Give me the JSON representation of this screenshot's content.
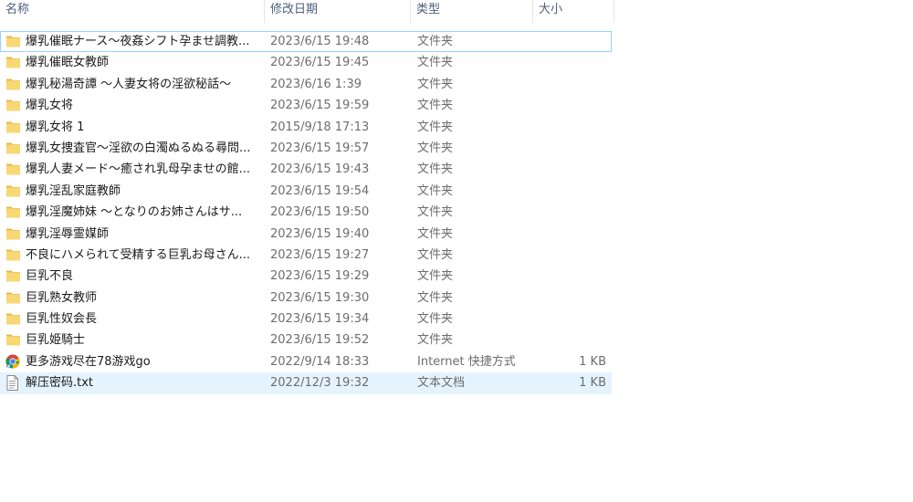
{
  "columns": {
    "name": "名称",
    "date": "修改日期",
    "type": "类型",
    "size": "大小"
  },
  "files": [
    {
      "name": "爆乳催眠ナース～夜姦シフト孕ませ調教...",
      "date": "2023/6/15 19:48",
      "type": "文件夹",
      "size": "",
      "icon": "folder-icon"
    },
    {
      "name": "爆乳催眠女教師",
      "date": "2023/6/15 19:45",
      "type": "文件夹",
      "size": "",
      "icon": "folder-icon"
    },
    {
      "name": "爆乳秘湯奇譚 ～人妻女将の淫欲秘話～",
      "date": "2023/6/16 1:39",
      "type": "文件夹",
      "size": "",
      "icon": "folder-icon"
    },
    {
      "name": "爆乳女将",
      "date": "2023/6/15 19:59",
      "type": "文件夹",
      "size": "",
      "icon": "folder-icon"
    },
    {
      "name": "爆乳女将 1",
      "date": "2015/9/18 17:13",
      "type": "文件夹",
      "size": "",
      "icon": "folder-icon"
    },
    {
      "name": "爆乳女捜査官～淫欲の白濁ぬるぬる尋問...",
      "date": "2023/6/15 19:57",
      "type": "文件夹",
      "size": "",
      "icon": "folder-icon"
    },
    {
      "name": "爆乳人妻メード～癒され乳母孕ませの館...",
      "date": "2023/6/15 19:43",
      "type": "文件夹",
      "size": "",
      "icon": "folder-icon"
    },
    {
      "name": "爆乳淫乱家庭教師",
      "date": "2023/6/15 19:54",
      "type": "文件夹",
      "size": "",
      "icon": "folder-icon"
    },
    {
      "name": "爆乳淫魔姉妹 ～となりのお姉さんはサ...",
      "date": "2023/6/15 19:50",
      "type": "文件夹",
      "size": "",
      "icon": "folder-icon"
    },
    {
      "name": "爆乳淫辱霊媒師",
      "date": "2023/6/15 19:40",
      "type": "文件夹",
      "size": "",
      "icon": "folder-icon"
    },
    {
      "name": "不良にハメられて受精する巨乳お母さん...",
      "date": "2023/6/15 19:27",
      "type": "文件夹",
      "size": "",
      "icon": "folder-icon"
    },
    {
      "name": "巨乳不良",
      "date": "2023/6/15 19:29",
      "type": "文件夹",
      "size": "",
      "icon": "folder-icon"
    },
    {
      "name": "巨乳熟女教师",
      "date": "2023/6/15 19:30",
      "type": "文件夹",
      "size": "",
      "icon": "folder-icon"
    },
    {
      "name": "巨乳性奴会長",
      "date": "2023/6/15 19:34",
      "type": "文件夹",
      "size": "",
      "icon": "folder-icon"
    },
    {
      "name": "巨乳姫騎士",
      "date": "2023/6/15 19:52",
      "type": "文件夹",
      "size": "",
      "icon": "folder-icon"
    },
    {
      "name": "更多游戏尽在78游戏go",
      "date": "2022/9/14 18:33",
      "type": "Internet 快捷方式",
      "size": "1 KB",
      "icon": "chrome-shortcut-icon"
    },
    {
      "name": "解压密码.txt",
      "date": "2022/12/3 19:32",
      "type": "文本文档",
      "size": "1 KB",
      "icon": "text-file-icon"
    }
  ],
  "state": {
    "focused_index": 0,
    "selected_index": 16
  },
  "colors": {
    "folder": "#f8d775",
    "folder_dark": "#e8b84a",
    "selected_bg": "#e5f3ff",
    "focus_border": "#99d1ff",
    "header_text": "#4c607a"
  }
}
